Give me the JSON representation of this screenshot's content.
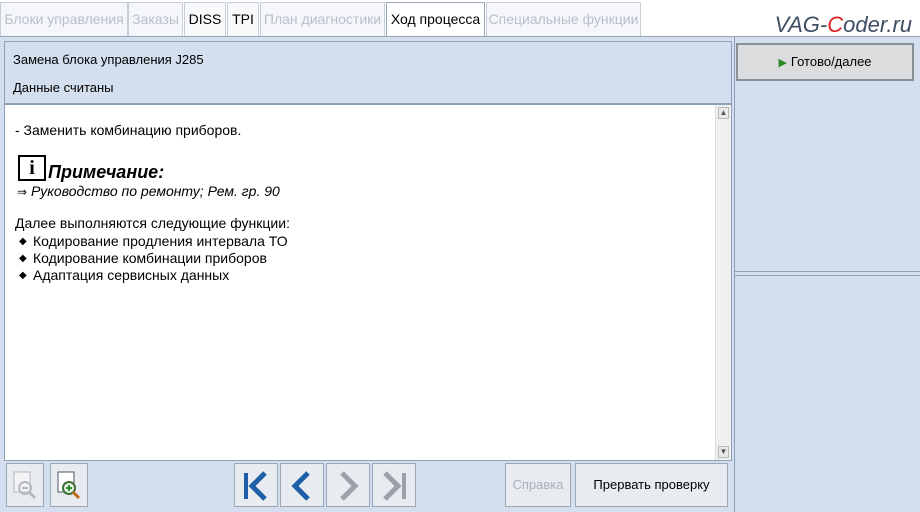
{
  "tabs": [
    {
      "label": "Блоки управления",
      "state": "disabled"
    },
    {
      "label": "Заказы",
      "state": "disabled"
    },
    {
      "label": "DISS",
      "state": "enabled"
    },
    {
      "label": "TPI",
      "state": "enabled"
    },
    {
      "label": "План диагностики",
      "state": "disabled"
    },
    {
      "label": "Ход процесса",
      "state": "active"
    },
    {
      "label": "Специальные функции",
      "state": "disabled"
    }
  ],
  "logo": {
    "pre": "VAG-",
    "mid": "C",
    "post": "oder.ru"
  },
  "header": {
    "title": "Замена блока управления J285",
    "status": "Данные считаны"
  },
  "content": {
    "line1": "- Заменить комбинацию приборов.",
    "note_title": "Примечание:",
    "note_link": "Руководство по ремонту; Рем. гр. 90",
    "functions_heading": "Далее выполняются следующие функции:",
    "functions": [
      "Кодирование продления интервала ТО",
      "Кодирование комбинации приборов",
      "Адаптация сервисных данных"
    ]
  },
  "right_panel": {
    "next_label": "Готово/далее"
  },
  "toolbar": {
    "help_label": "Справка",
    "abort_label": "Прервать проверку"
  },
  "colors": {
    "panel": "#d3dfee",
    "nav_blue": "#1f5fa8",
    "nav_disabled": "#9aa1aa"
  }
}
